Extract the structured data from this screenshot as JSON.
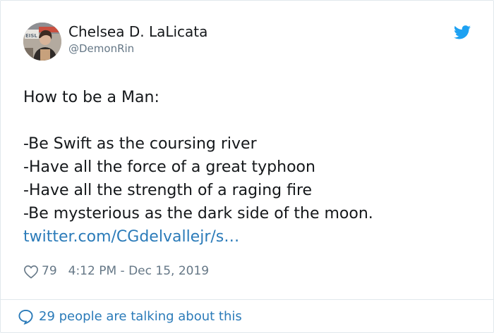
{
  "author": {
    "name": "Chelsea D. LaLicata",
    "handle": "@DemonRin",
    "avatar_icon": "profile-photo",
    "avatar_sign_text": "EISL"
  },
  "brand_icon": "twitter-bird-icon",
  "colors": {
    "brand": "#1da1f2",
    "link": "#2b7bb9",
    "muted": "#657786",
    "text": "#14171a",
    "border": "#e1e8ed"
  },
  "tweet": {
    "lines": [
      "How to be a Man:",
      "",
      "-Be Swift as the coursing river",
      "-Have all the force of a great typhoon",
      "-Have all the strength of a raging fire",
      "-Be mysterious as the dark side of the moon."
    ],
    "link": "twitter.com/CGdelvallejr/s…"
  },
  "meta": {
    "likes": "79",
    "timestamp": "4:12 PM - Dec 15, 2019"
  },
  "footer": {
    "talking": "29 people are talking about this"
  }
}
